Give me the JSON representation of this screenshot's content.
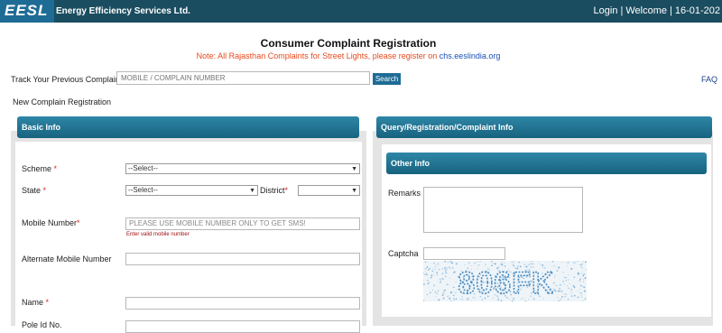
{
  "header": {
    "logo_text": "EESL",
    "brand": "Energy Efficiency Services Ltd.",
    "login": "Login",
    "separator": "|",
    "welcome": "Welcome",
    "date": "16-01-202"
  },
  "title": "Consumer Complaint Registration",
  "note": {
    "text": "Note: All Rajasthan Complaints for Street Lights, please register on ",
    "link": "chs.eeslindia.org"
  },
  "track": {
    "label": "Track Your Previous Complain :",
    "placeholder": "MOBILE / COMPLAIN NUMBER",
    "button": "Search"
  },
  "faq": "FAQ",
  "new_registration": "New Complain Registration",
  "basic_info": {
    "heading": "Basic Info",
    "scheme_label": "Scheme",
    "scheme_value": "--Select--",
    "state_label": "State",
    "state_value": "--Select--",
    "district_label": "District",
    "district_value": "",
    "mobile_label": "Mobile Number",
    "mobile_placeholder": "PLEASE USE MOBILE NUMBER ONLY TO GET SMS!",
    "mobile_error": "Enter valid mobile number",
    "alt_mobile_label": "Alternate Mobile Number",
    "name_label": "Name",
    "pole_label": "Pole Id No."
  },
  "query_info": {
    "heading": "Query/Registration/Complaint Info"
  },
  "other_info": {
    "heading": "Other Info",
    "remarks_label": "Remarks",
    "captcha_label": "Captcha",
    "captcha_text": "806FK"
  },
  "colors": {
    "header_bg": "#1b4d60",
    "accent": "#1e6c96",
    "note": "#e8491c",
    "required": "#d9261c"
  }
}
